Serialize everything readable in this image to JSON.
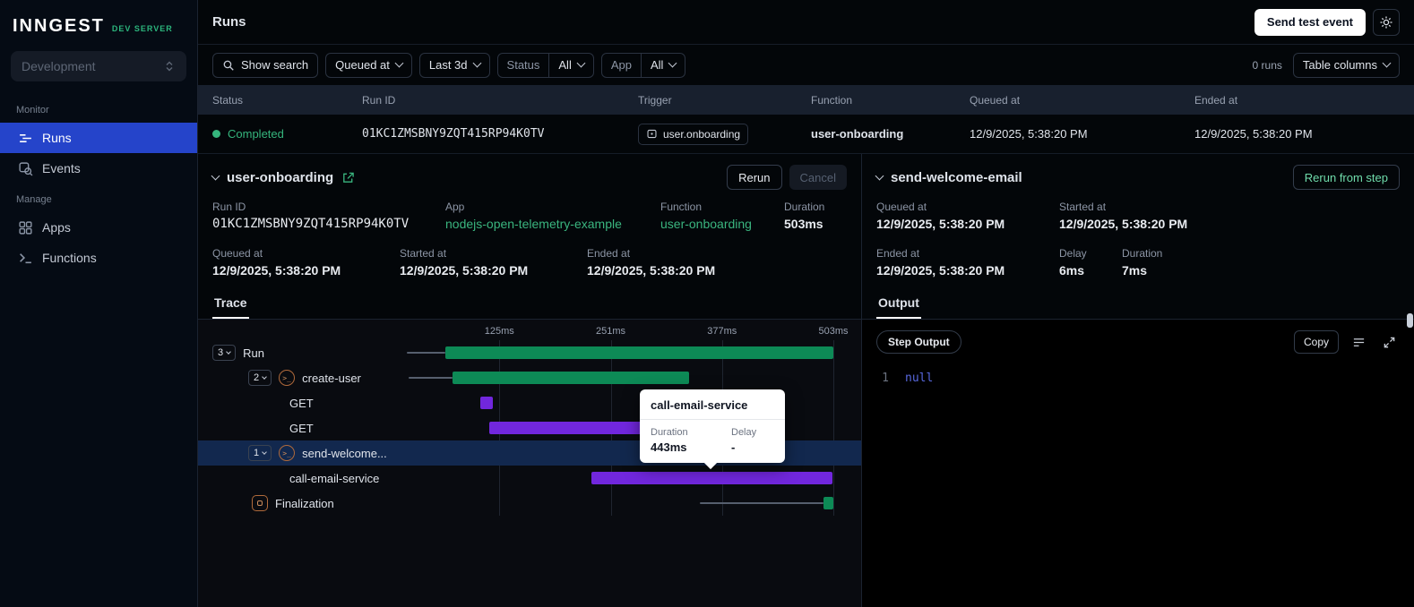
{
  "colors": {
    "accent_green": "#2cb67d",
    "active_blue": "#2544ca",
    "completed_green": "#35b57d",
    "bar_green": "#0d8a56",
    "bar_purple": "#7127dd",
    "selected_row": "#12284e"
  },
  "sidebar": {
    "logo": "INNGEST",
    "badge": "DEV SERVER",
    "environment": "Development",
    "monitor_label": "Monitor",
    "manage_label": "Manage",
    "runs": "Runs",
    "events": "Events",
    "apps": "Apps",
    "functions": "Functions"
  },
  "topbar": {
    "title": "Runs",
    "send_test_event_label": "Send test event"
  },
  "filterbar": {
    "show_search": "Show search",
    "queued_at": "Queued at",
    "time_range": "Last 3d",
    "status_label": "Status",
    "status_value": "All",
    "app_label": "App",
    "app_value": "All",
    "run_count": "0 runs",
    "table_columns": "Table columns"
  },
  "table": {
    "headers": {
      "status": "Status",
      "run_id": "Run ID",
      "trigger": "Trigger",
      "function": "Function",
      "queued_at": "Queued at",
      "ended_at": "Ended at"
    },
    "row": {
      "status": "Completed",
      "run_id": "01KC1ZMSBNY9ZQT415RP94K0TV",
      "trigger": "user.onboarding",
      "function": "user-onboarding",
      "queued_at": "12/9/2025, 5:38:20 PM",
      "ended_at": "12/9/2025, 5:38:20 PM"
    }
  },
  "run_panel": {
    "title": "user-onboarding",
    "rerun": "Rerun",
    "cancel": "Cancel",
    "run_id_label": "Run ID",
    "run_id": "01KC1ZMSBNY9ZQT415RP94K0TV",
    "app_label": "App",
    "app": "nodejs-open-telemetry-example",
    "function_label": "Function",
    "function": "user-onboarding",
    "duration_label": "Duration",
    "duration": "503ms",
    "queued_label": "Queued at",
    "queued": "12/9/2025, 5:38:20 PM",
    "started_label": "Started at",
    "started": "12/9/2025, 5:38:20 PM",
    "ended_label": "Ended at",
    "ended": "12/9/2025, 5:38:20 PM",
    "tab": "Trace"
  },
  "step_panel": {
    "title": "send-welcome-email",
    "rerun_from_step": "Rerun from step",
    "queued_label": "Queued at",
    "queued": "12/9/2025, 5:38:20 PM",
    "started_label": "Started at",
    "started": "12/9/2025, 5:38:20 PM",
    "ended_label": "Ended at",
    "ended": "12/9/2025, 5:38:20 PM",
    "delay_label": "Delay",
    "delay": "6ms",
    "duration_label": "Duration",
    "duration": "7ms",
    "tab": "Output",
    "output_badge": "Step Output",
    "copy": "Copy",
    "line_number": "1",
    "code": "null"
  },
  "tooltip": {
    "title": "call-email-service",
    "duration_label": "Duration",
    "duration": "443ms",
    "delay_label": "Delay",
    "delay": "-"
  },
  "chart_data": {
    "type": "trace-waterfall",
    "title": "Run trace",
    "total_ms": 503,
    "axis_ticks_ms": [
      125,
      251,
      377,
      503
    ],
    "rows": [
      {
        "name": "Run",
        "depth": 0,
        "expand": "3",
        "delay": [
          20,
          64
        ],
        "bar": [
          64,
          503
        ],
        "color": "green"
      },
      {
        "name": "create-user",
        "depth": 1,
        "expand": "2",
        "icon": "step",
        "delay": [
          22,
          72
        ],
        "bar": [
          72,
          340
        ],
        "color": "green"
      },
      {
        "name": "GET",
        "depth": 2,
        "bar": [
          103,
          118
        ],
        "color": "purple"
      },
      {
        "name": "GET",
        "depth": 2,
        "bar": [
          114,
          308
        ],
        "color": "purple"
      },
      {
        "name": "send-welcome...",
        "depth": 1,
        "expand": "1",
        "icon": "step",
        "selected": true,
        "bar": [
          285,
          292
        ],
        "color": "purple"
      },
      {
        "name": "call-email-service",
        "depth": 2,
        "bar": [
          229,
          502
        ],
        "color": "purple"
      },
      {
        "name": "Finalization",
        "depth": 1,
        "icon": "finalization",
        "delay": [
          352,
          492
        ],
        "bar": [
          492,
          503
        ],
        "color": "green"
      }
    ]
  }
}
